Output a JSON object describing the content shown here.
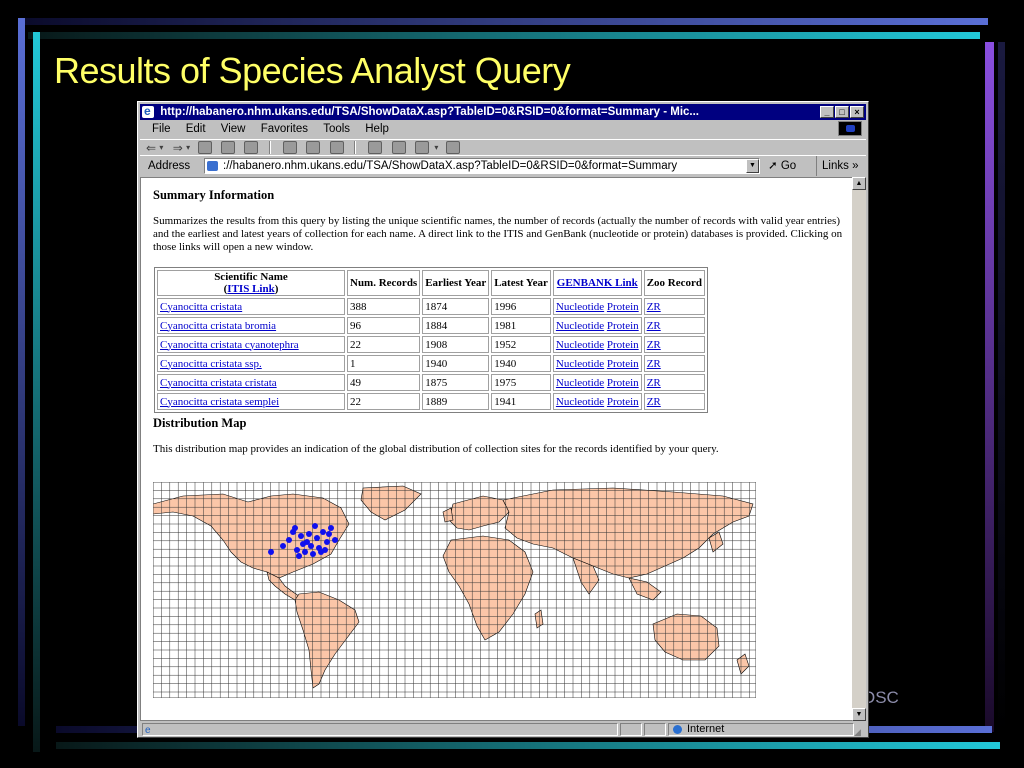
{
  "slide": {
    "title": "Results of Species Analyst Query",
    "footer_text": "OSC",
    "colors": {
      "title": "#ffff66",
      "frame_blue": "#5a6fd6",
      "frame_cyan": "#22c8d8",
      "frame_purple": "#8a4fe0",
      "background": "#000000"
    }
  },
  "browser": {
    "window_title": "http://habanero.nhm.ukans.edu/TSA/ShowDataX.asp?TableID=0&RSID=0&format=Summary - Mic...",
    "menu": [
      "File",
      "Edit",
      "View",
      "Favorites",
      "Tools",
      "Help"
    ],
    "toolbar_icons": [
      "back-icon",
      "forward-icon",
      "stop-icon",
      "refresh-icon",
      "home-icon",
      "search-icon",
      "favorites-icon",
      "history-icon",
      "mail-icon",
      "print-icon",
      "edit-icon",
      "discuss-icon"
    ],
    "address_label": "Address",
    "address_value": "://habanero.nhm.ukans.edu/TSA/ShowDataX.asp?TableID=0&RSID=0&format=Summary",
    "go_label": "Go",
    "links_label": "Links",
    "links_chevron": "»",
    "status_zone": "Internet"
  },
  "page": {
    "summary_heading": "Summary Information",
    "summary_text": "Summarizes the results from this query by listing the unique scientific names, the number of records (actually the number of records with valid year entries) and the earliest and latest years of collection for each name. A direct link to the ITIS and GenBank (nucleotide or protein) databases is provided. Clicking on those links will open a new window.",
    "table": {
      "headers": {
        "scientific_name": "Scientific Name",
        "itis_link": "ITIS Link",
        "num_records": "Num. Records",
        "earliest_year": "Earliest Year",
        "latest_year": "Latest Year",
        "genbank_link": "GENBANK Link",
        "zoo_record": "Zoo Record"
      },
      "rows": [
        {
          "name": "Cyanocitta cristata",
          "records": "388",
          "earliest": "1874",
          "latest": "1996",
          "nucleotide": "Nucleotide",
          "protein": "Protein",
          "zr": "ZR"
        },
        {
          "name": "Cyanocitta cristata bromia",
          "records": "96",
          "earliest": "1884",
          "latest": "1981",
          "nucleotide": "Nucleotide",
          "protein": "Protein",
          "zr": "ZR"
        },
        {
          "name": "Cyanocitta cristata cyanotephra",
          "records": "22",
          "earliest": "1908",
          "latest": "1952",
          "nucleotide": "Nucleotide",
          "protein": "Protein",
          "zr": "ZR"
        },
        {
          "name": "Cyanocitta cristata ssp.",
          "records": "1",
          "earliest": "1940",
          "latest": "1940",
          "nucleotide": "Nucleotide",
          "protein": "Protein",
          "zr": "ZR"
        },
        {
          "name": "Cyanocitta cristata cristata",
          "records": "49",
          "earliest": "1875",
          "latest": "1975",
          "nucleotide": "Nucleotide",
          "protein": "Protein",
          "zr": "ZR"
        },
        {
          "name": "Cyanocitta cristata semplei",
          "records": "22",
          "earliest": "1889",
          "latest": "1941",
          "nucleotide": "Nucleotide",
          "protein": "Protein",
          "zr": "ZR"
        }
      ]
    },
    "map_heading": "Distribution Map",
    "map_text": "This distribution map provides an indication of the global distribution of collection sites for the records identified by your query.",
    "map_colors": {
      "land": "#fbc6a8",
      "ocean": "#ffffff",
      "grid": "#333333",
      "points": "#1010ee"
    }
  }
}
